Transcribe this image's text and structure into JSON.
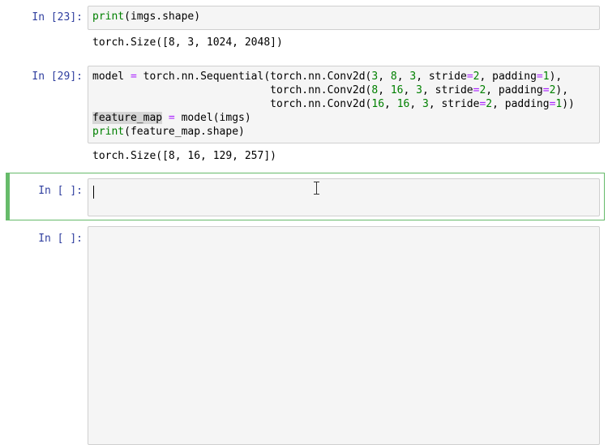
{
  "cells": [
    {
      "prompt": "In [23]:",
      "code": [
        [
          {
            "t": "print",
            "c": "kw"
          },
          {
            "t": "(imgs.shape)"
          }
        ]
      ],
      "output": "torch.Size([8, 3, 1024, 2048])"
    },
    {
      "prompt": "In [29]:",
      "code": [
        [
          {
            "t": "model "
          },
          {
            "t": "=",
            "c": "op"
          },
          {
            "t": " torch.nn.Sequential(torch.nn.Conv2d("
          },
          {
            "t": "3",
            "c": "num"
          },
          {
            "t": ", "
          },
          {
            "t": "8",
            "c": "num"
          },
          {
            "t": ", "
          },
          {
            "t": "3",
            "c": "num"
          },
          {
            "t": ", stride"
          },
          {
            "t": "=",
            "c": "op"
          },
          {
            "t": "2",
            "c": "num"
          },
          {
            "t": ", padding"
          },
          {
            "t": "=",
            "c": "op"
          },
          {
            "t": "1",
            "c": "num"
          },
          {
            "t": "),"
          }
        ],
        [
          {
            "t": "                            torch.nn.Conv2d("
          },
          {
            "t": "8",
            "c": "num"
          },
          {
            "t": ", "
          },
          {
            "t": "16",
            "c": "num"
          },
          {
            "t": ", "
          },
          {
            "t": "3",
            "c": "num"
          },
          {
            "t": ", stride"
          },
          {
            "t": "=",
            "c": "op"
          },
          {
            "t": "2",
            "c": "num"
          },
          {
            "t": ", padding"
          },
          {
            "t": "=",
            "c": "op"
          },
          {
            "t": "2",
            "c": "num"
          },
          {
            "t": "),"
          }
        ],
        [
          {
            "t": "                            torch.nn.Conv2d("
          },
          {
            "t": "16",
            "c": "num"
          },
          {
            "t": ", "
          },
          {
            "t": "16",
            "c": "num"
          },
          {
            "t": ", "
          },
          {
            "t": "3",
            "c": "num"
          },
          {
            "t": ", stride"
          },
          {
            "t": "=",
            "c": "op"
          },
          {
            "t": "2",
            "c": "num"
          },
          {
            "t": ", padding"
          },
          {
            "t": "=",
            "c": "op"
          },
          {
            "t": "1",
            "c": "num"
          },
          {
            "t": "))"
          }
        ],
        [
          {
            "t": "feature_map",
            "c": "hl"
          },
          {
            "t": " "
          },
          {
            "t": "=",
            "c": "op"
          },
          {
            "t": " model(imgs)"
          }
        ],
        [
          {
            "t": "print",
            "c": "kw"
          },
          {
            "t": "(feature_map.shape)"
          }
        ]
      ],
      "output": "torch.Size([8, 16, 129, 257])"
    },
    {
      "prompt": "In [ ]:",
      "code": [],
      "output": ""
    },
    {
      "prompt": "In [ ]:",
      "code": [],
      "output": ""
    }
  ]
}
